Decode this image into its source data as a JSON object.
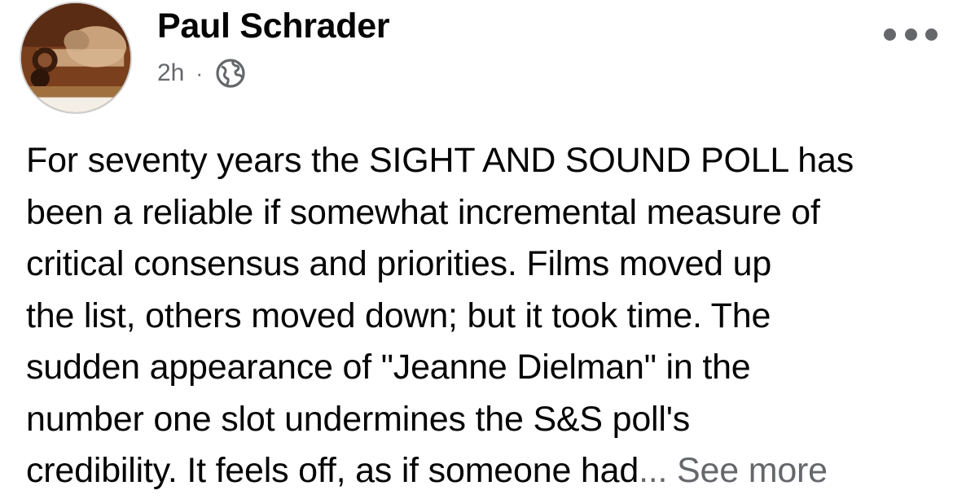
{
  "post": {
    "author": "Paul Schrader",
    "timestamp": "2h",
    "separator": "·",
    "audience_icon": "globe-icon",
    "more_icon": "more-options-icon",
    "text_lines": [
      "For seventy years the SIGHT AND SOUND POLL has",
      "been a reliable if somewhat incremental measure of",
      "critical consensus and priorities. Films moved up",
      "the list, others moved down; but it took time. The",
      "sudden appearance of \"Jeanne Dielman\" in the",
      "number one slot undermines the S&S poll's",
      "credibility. It feels off, as if someone had"
    ],
    "ellipsis": "...",
    "see_more": " See more"
  },
  "colors": {
    "text": "#050505",
    "secondary_text": "#65676b",
    "background": "#ffffff"
  }
}
